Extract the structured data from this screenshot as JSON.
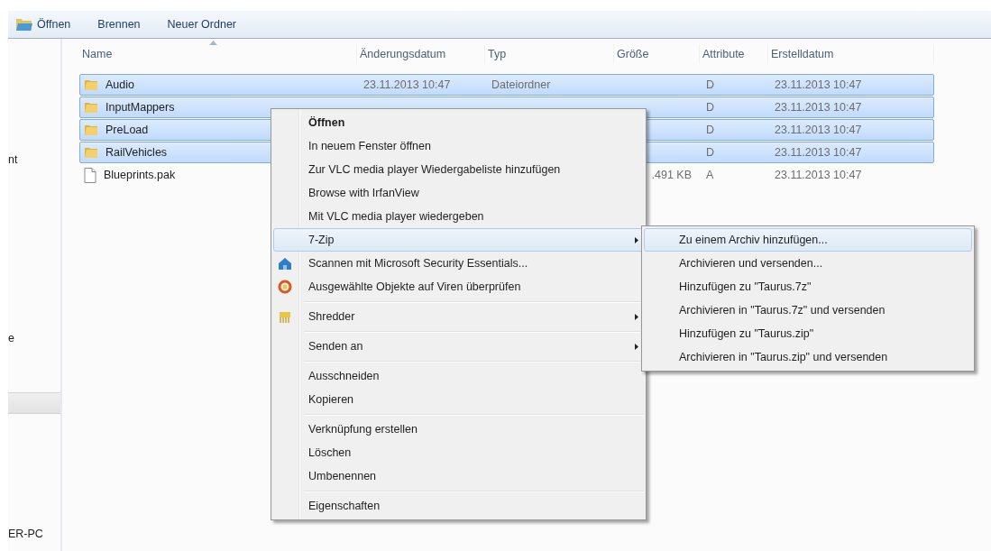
{
  "toolbar": {
    "buttons": [
      {
        "label": "Öffnen",
        "icon": true
      },
      {
        "label": "Brennen",
        "icon": false
      },
      {
        "label": "Neuer Ordner",
        "icon": false
      }
    ]
  },
  "nav_pane": {
    "items": [
      {
        "label": "nt",
        "kind": "text"
      },
      {
        "label": "e",
        "kind": "text"
      },
      {
        "kind": "bar"
      },
      {
        "label": "ER-PC",
        "kind": "text"
      }
    ]
  },
  "file_list": {
    "columns": [
      {
        "label": "Name",
        "sorted": true
      },
      {
        "label": "Änderungsdatum",
        "sorted": false
      },
      {
        "label": "Typ",
        "sorted": false
      },
      {
        "label": "Größe",
        "sorted": false
      },
      {
        "label": "Attribute",
        "sorted": false
      },
      {
        "label": "Erstelldatum",
        "sorted": false
      }
    ],
    "rows": [
      {
        "name": "Audio",
        "kind": "folder",
        "modified": "23.11.2013 10:47",
        "type": "Dateiordner",
        "attributes": "D",
        "created": "23.11.2013 10:47",
        "selected": true
      },
      {
        "name": "InputMappers",
        "kind": "folder",
        "attributes": "D",
        "created": "23.11.2013 10:47",
        "selected": true
      },
      {
        "name": "PreLoad",
        "kind": "folder",
        "attributes": "D",
        "created": "23.11.2013 10:47",
        "selected": true
      },
      {
        "name": "RailVehicles",
        "kind": "folder",
        "attributes": "D",
        "created": "23.11.2013 10:47",
        "selected": true
      },
      {
        "name": "Blueprints.pak",
        "kind": "file",
        "size": ".491 KB",
        "attributes": "A",
        "created": "23.11.2013 10:47",
        "selected": false
      }
    ]
  },
  "context_menu": {
    "items": [
      {
        "kind": "item",
        "label": "Öffnen",
        "bold": true,
        "submenu": false,
        "selected": false
      },
      {
        "kind": "item",
        "label": "In neuem Fenster öffnen",
        "bold": false,
        "submenu": false,
        "selected": false
      },
      {
        "kind": "item",
        "label": "Zur VLC media player Wiedergabeliste hinzufügen",
        "bold": false,
        "submenu": false,
        "selected": false
      },
      {
        "kind": "item",
        "label": "Browse with IrfanView",
        "bold": false,
        "submenu": false,
        "selected": false
      },
      {
        "kind": "item",
        "label": "Mit VLC media player wiedergeben",
        "bold": false,
        "submenu": false,
        "selected": false
      },
      {
        "kind": "item",
        "label": "7-Zip",
        "bold": false,
        "submenu": true,
        "selected": true
      },
      {
        "kind": "scan",
        "label": "Scannen mit Microsoft Security Essentials...",
        "bold": false,
        "submenu": false,
        "selected": false
      },
      {
        "kind": "antivirus",
        "label": "Ausgewählte Objekte auf Viren überprüfen",
        "bold": false,
        "submenu": false,
        "selected": false
      },
      {
        "kind": "separator"
      },
      {
        "kind": "shredder",
        "label": "Shredder",
        "bold": false,
        "submenu": true,
        "selected": false
      },
      {
        "kind": "separator"
      },
      {
        "kind": "item",
        "label": "Senden an",
        "bold": false,
        "submenu": true,
        "selected": false
      },
      {
        "kind": "separator"
      },
      {
        "kind": "item",
        "label": "Ausschneiden",
        "bold": false,
        "submenu": false,
        "selected": false
      },
      {
        "kind": "item",
        "label": "Kopieren",
        "bold": false,
        "submenu": false,
        "selected": false
      },
      {
        "kind": "separator"
      },
      {
        "kind": "item",
        "label": "Verknüpfung erstellen",
        "bold": false,
        "submenu": false,
        "selected": false
      },
      {
        "kind": "item",
        "label": "Löschen",
        "bold": false,
        "submenu": false,
        "selected": false
      },
      {
        "kind": "item",
        "label": "Umbenennen",
        "bold": false,
        "submenu": false,
        "selected": false
      },
      {
        "kind": "separator"
      },
      {
        "kind": "item",
        "label": "Eigenschaften",
        "bold": false,
        "submenu": false,
        "selected": false
      }
    ]
  },
  "submenu": {
    "items": [
      {
        "label": "Zu einem Archiv hinzufügen...",
        "selected": true
      },
      {
        "label": "Archivieren und versenden...",
        "selected": false
      },
      {
        "label": "Hinzufügen zu \"Taurus.7z\"",
        "selected": false
      },
      {
        "label": "Archivieren in \"Taurus.7z\" und versenden",
        "selected": false
      },
      {
        "label": "Hinzufügen zu \"Taurus.zip\"",
        "selected": false
      },
      {
        "label": "Archivieren in \"Taurus.zip\" und versenden",
        "selected": false
      }
    ]
  }
}
